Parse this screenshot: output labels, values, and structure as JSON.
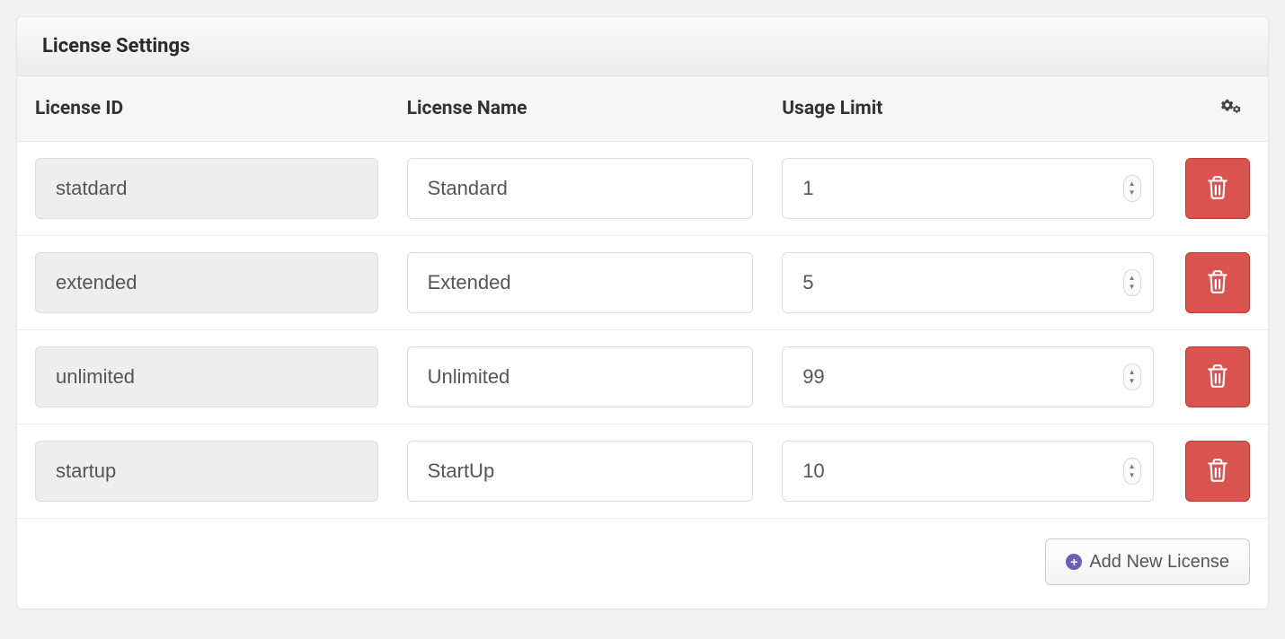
{
  "panel": {
    "title": "License Settings"
  },
  "columns": {
    "id": "License ID",
    "name": "License Name",
    "limit": "Usage Limit"
  },
  "rows": [
    {
      "id": "statdard",
      "name": "Standard",
      "limit": "1"
    },
    {
      "id": "extended",
      "name": "Extended",
      "limit": "5"
    },
    {
      "id": "unlimited",
      "name": "Unlimited",
      "limit": "99"
    },
    {
      "id": "startup",
      "name": "StartUp",
      "limit": "10"
    }
  ],
  "footer": {
    "add_label": "Add New License"
  }
}
